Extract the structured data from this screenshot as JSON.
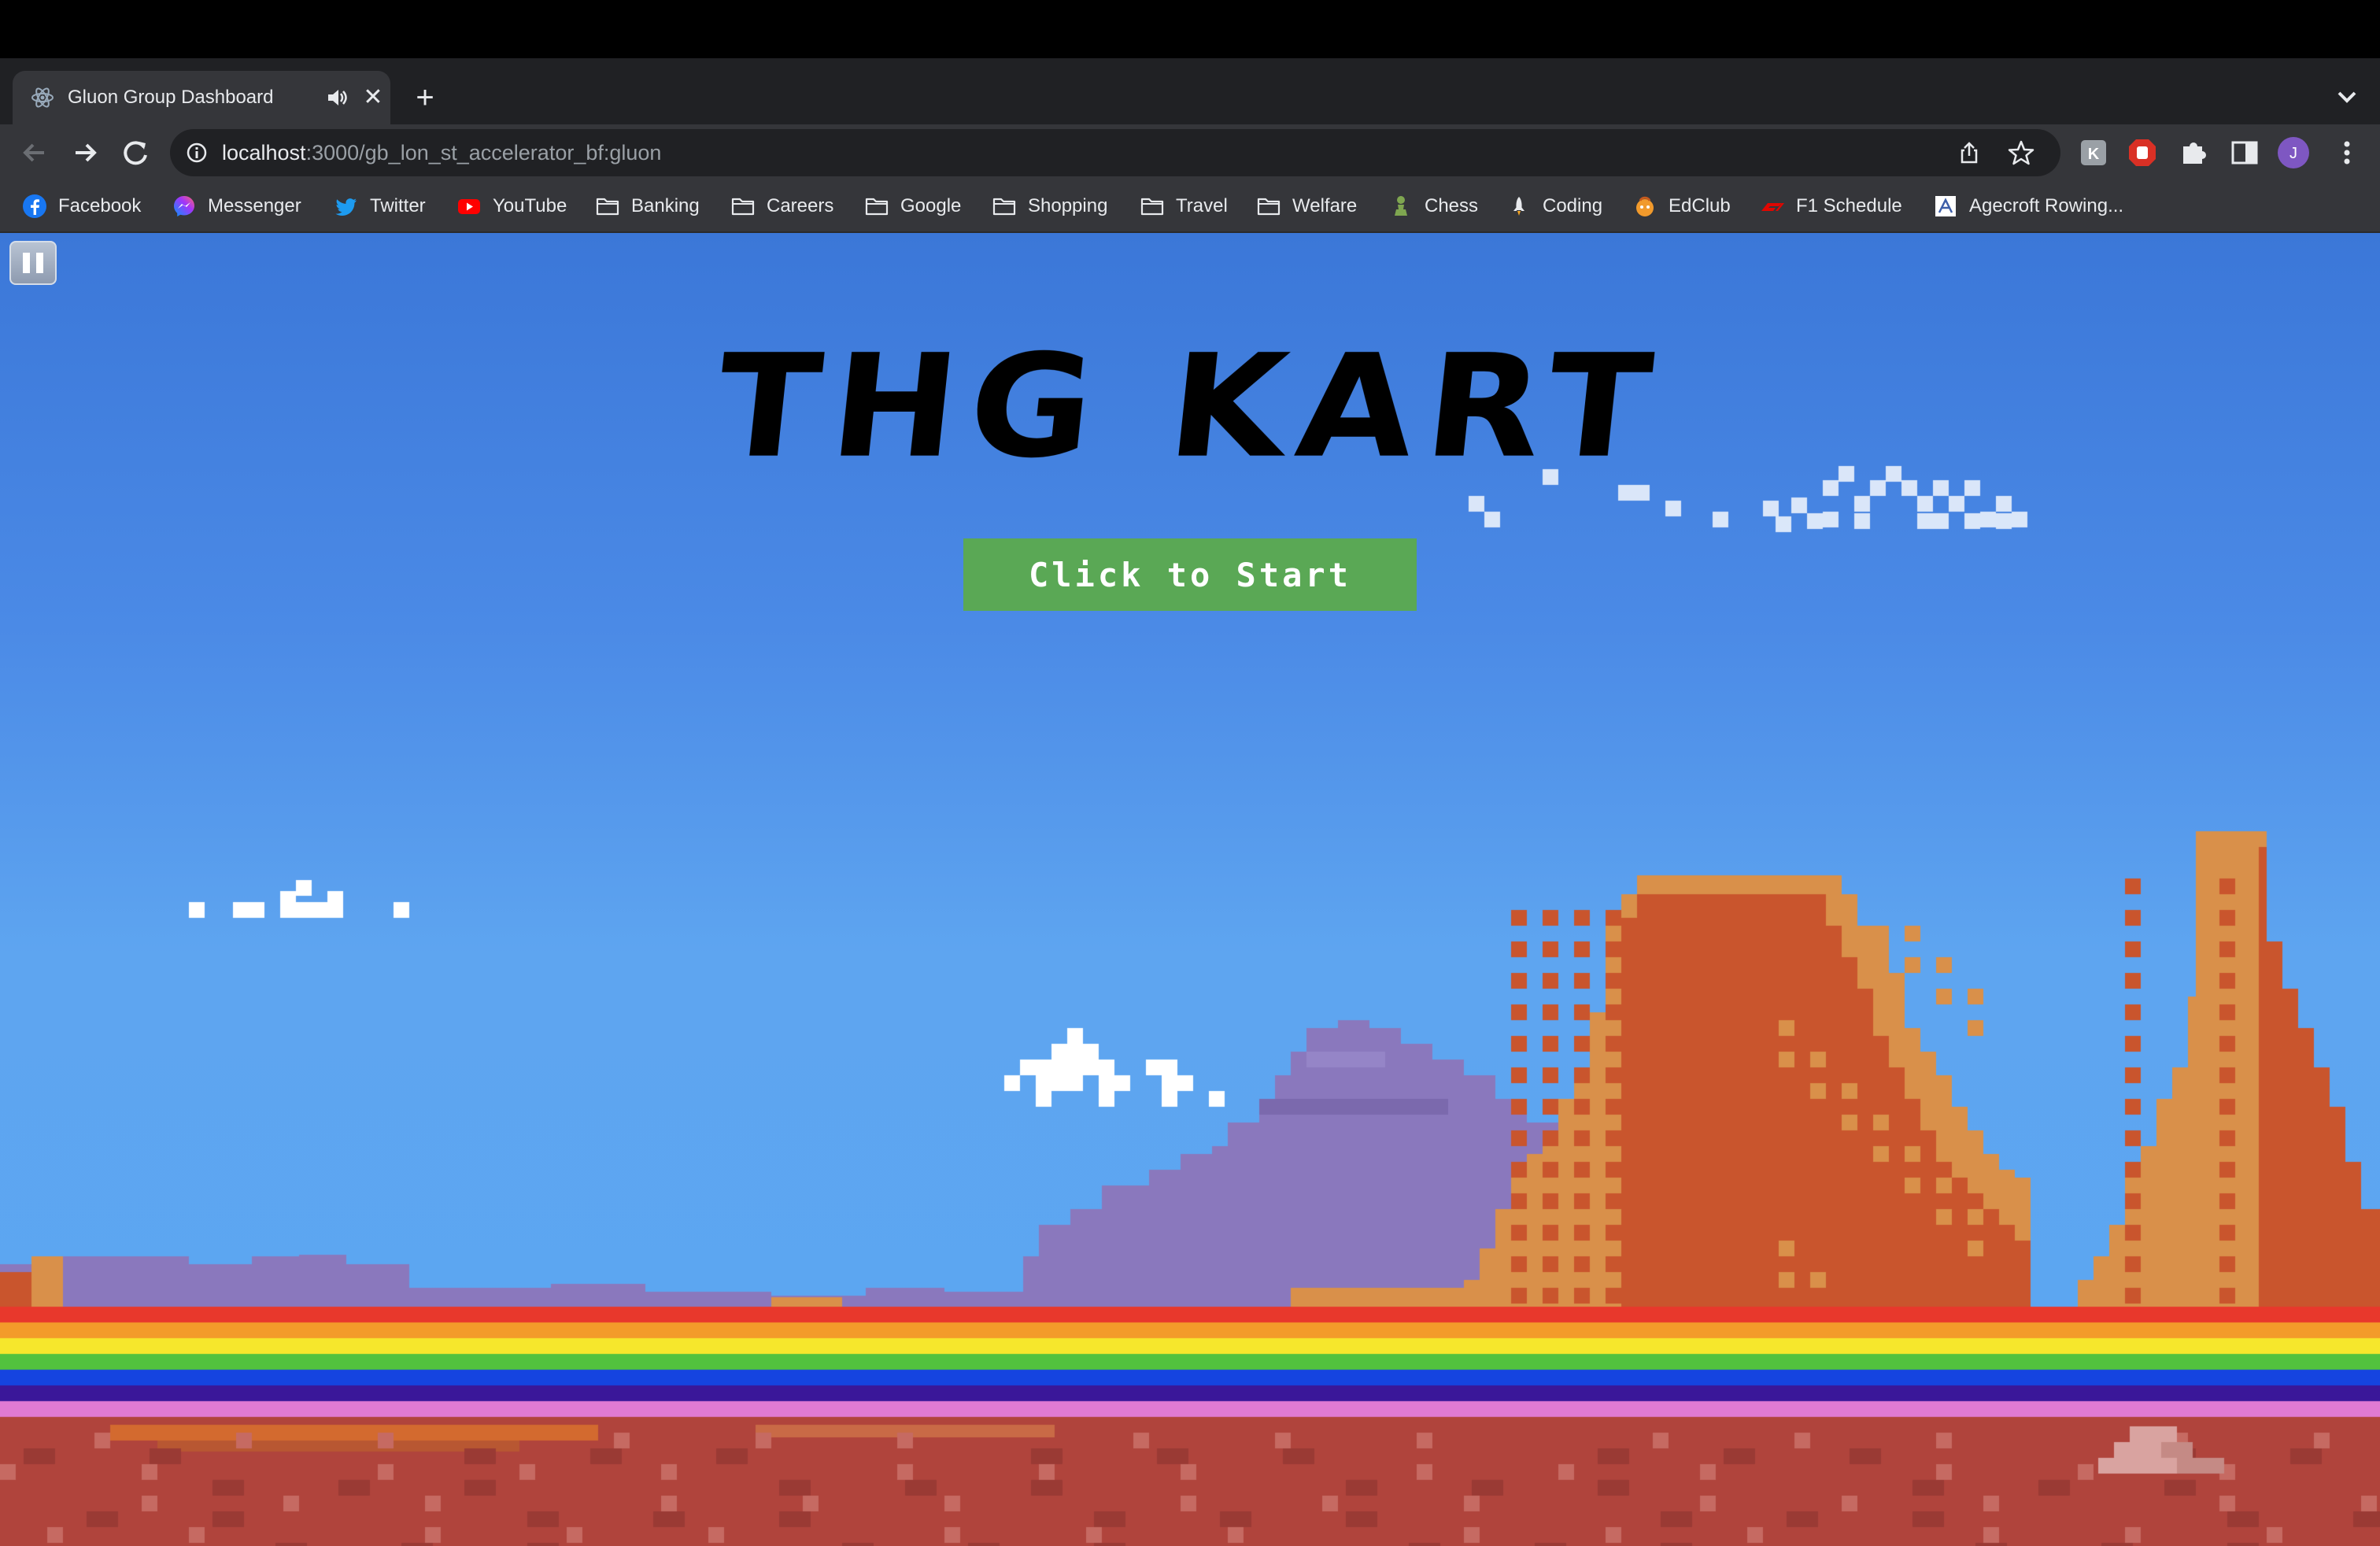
{
  "browser": {
    "tab": {
      "title": "Gluon Group Dashboard",
      "favicon": "react-atom-icon",
      "audio_icon": "speaker-icon",
      "close_icon": "close-icon"
    },
    "new_tab_icon": "plus-icon",
    "tab_search_icon": "chevron-down-icon",
    "toolbar": {
      "back_icon": "arrow-left-icon",
      "forward_icon": "arrow-right-icon",
      "reload_icon": "reload-icon",
      "site_info_icon": "info-icon",
      "url_host": "localhost",
      "url_rest": ":3000/gb_lon_st_accelerator_bf:gluon",
      "share_icon": "share-icon",
      "bookmark_icon": "star-icon",
      "extensions": [
        "extension-k-icon",
        "extension-block-icon",
        "puzzle-icon",
        "side-panel-icon"
      ],
      "profile_initial": "J",
      "menu_icon": "kebab-menu-icon"
    },
    "bookmarks": [
      {
        "label": "Facebook",
        "icon": "facebook-icon"
      },
      {
        "label": "Messenger",
        "icon": "messenger-icon"
      },
      {
        "label": "Twitter",
        "icon": "twitter-icon"
      },
      {
        "label": "YouTube",
        "icon": "youtube-icon"
      },
      {
        "label": "Banking",
        "icon": "folder-icon"
      },
      {
        "label": "Careers",
        "icon": "folder-icon"
      },
      {
        "label": "Google",
        "icon": "folder-icon"
      },
      {
        "label": "Shopping",
        "icon": "folder-icon"
      },
      {
        "label": "Travel",
        "icon": "folder-icon"
      },
      {
        "label": "Welfare",
        "icon": "folder-icon"
      },
      {
        "label": "Chess",
        "icon": "chess-pawn-icon"
      },
      {
        "label": "Coding",
        "icon": "rocket-icon"
      },
      {
        "label": "EdClub",
        "icon": "edclub-icon"
      },
      {
        "label": "F1 Schedule",
        "icon": "f1-icon"
      },
      {
        "label": "Agecroft Rowing...",
        "icon": "agecroft-icon"
      }
    ]
  },
  "game": {
    "title": "THG KART",
    "start_button": "Click to Start",
    "pause_icon": "pause-icon",
    "colors": {
      "sky_top": "#3b77d8",
      "sky_bottom": "#5ba6f2",
      "start_button": "#5aa855",
      "mesa_orange": "#d9904a",
      "mesa_red": "#c9552d",
      "mountain_purple": "#8a78bd",
      "ground": "#b0443c",
      "rainbow": [
        "#e8382c",
        "#f39b2a",
        "#f6e72c",
        "#52c23e",
        "#1544e0",
        "#3a1799",
        "#e07ad3"
      ]
    }
  }
}
